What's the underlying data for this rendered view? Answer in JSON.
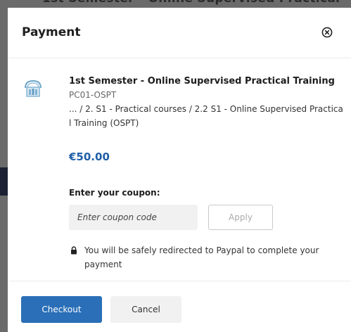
{
  "backdrop": {
    "partial_text": "1st Semester - Online Supervised Practical"
  },
  "modal": {
    "title": "Payment",
    "close_icon": "close-circle-icon"
  },
  "course": {
    "icon": "institution-logo-icon",
    "title": "1st Semester - Online Supervised Practical Training",
    "code": "PC01-OSPT",
    "path": "... / 2. S1 - Practical courses / 2.2 S1 - Online Supervised Practical Training (OSPT)",
    "price": "€50.00",
    "price_color": "#1f5fa8"
  },
  "coupon": {
    "label": "Enter your coupon:",
    "placeholder": "Enter coupon code",
    "apply_label": "Apply"
  },
  "notice": {
    "icon": "lock-icon",
    "text": "You will be safely redirected to Paypal to complete your payment"
  },
  "footer": {
    "checkout_label": "Checkout",
    "cancel_label": "Cancel",
    "checkout_color": "#2a6fb7"
  }
}
